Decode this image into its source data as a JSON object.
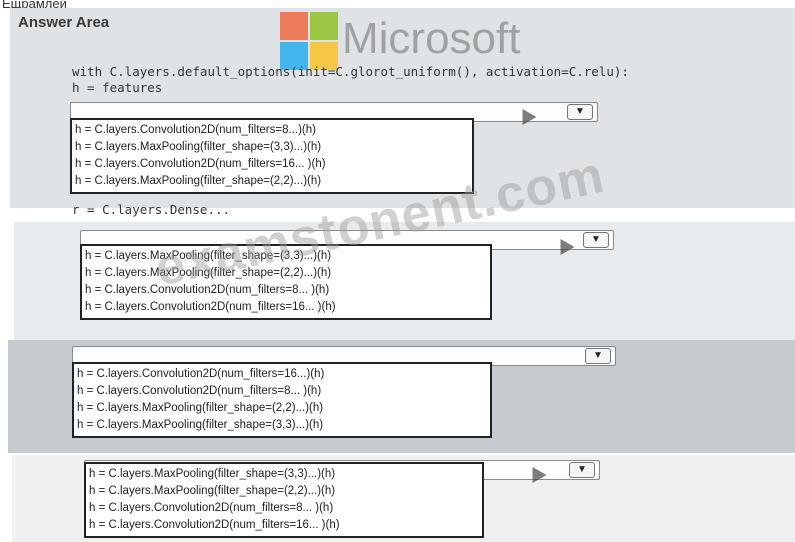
{
  "header": {
    "top_word": "Ещрамлей",
    "answer_area": "Answer Area"
  },
  "code": {
    "with_line": "with C.layers.default_options(init=C.glorot_uniform(), activation=C.relu):",
    "h_line": "h = features",
    "r_line": "r = C.layers.Dense..."
  },
  "brand": {
    "logo_text": "Microsoft",
    "colors": [
      "#f25022",
      "#7fba00",
      "#00a4ef",
      "#ffb900"
    ]
  },
  "watermark": {
    "text": "examstonent.com"
  },
  "dropdowns": [
    {
      "options": [
        "h = C.layers.Convolution2D(num_filters=8...)(h)",
        "h = C.layers.MaxPooling(filter_shape=(3,3)...)(h)",
        "h = C.layers.Convolution2D(num_filters=16... )(h)",
        "h = C.layers.MaxPooling(filter_shape=(2,2)...)(h)"
      ]
    },
    {
      "options": [
        "h = C.layers.MaxPooling(filter_shape=(3,3)...)(h)",
        "h = C.layers.MaxPooling(filter_shape=(2,2)...)(h)",
        "h = C.layers.Convolution2D(num_filters=8... )(h)",
        "h = C.layers.Convolution2D(num_filters=16... )(h)"
      ]
    },
    {
      "options": [
        "h = C.layers.Convolution2D(num_filters=16...)(h)",
        "h = C.layers.Convolution2D(num_filters=8... )(h)",
        "h = C.layers.MaxPooling(filter_shape=(2,2)...)(h)",
        "h = C.layers.MaxPooling(filter_shape=(3,3)...)(h)"
      ]
    },
    {
      "options": [
        "h = C.layers.MaxPooling(filter_shape=(3,3)...)(h)",
        "h = C.layers.MaxPooling(filter_shape=(2,2)...)(h)",
        "h = C.layers.Convolution2D(num_filters=8... )(h)",
        "h = C.layers.Convolution2D(num_filters=16... )(h)"
      ]
    }
  ]
}
